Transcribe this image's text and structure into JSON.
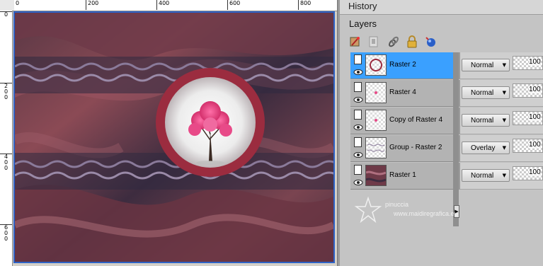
{
  "ruler": {
    "top_ticks": [
      "0",
      "200",
      "400",
      "600",
      "800"
    ],
    "left_ticks": [
      "0",
      "2\n0\n0",
      "4\n0\n0",
      "6\n0\n0"
    ]
  },
  "history": {
    "title": "History"
  },
  "layers": {
    "title": "Layers",
    "toolbar": [
      {
        "icon": "new-raster-layer-icon"
      },
      {
        "icon": "layer-properties-icon"
      },
      {
        "icon": "link-icon"
      },
      {
        "icon": "lock-icon"
      },
      {
        "icon": "blue-ball-icon"
      }
    ],
    "rows": [
      {
        "name": "Raster 2",
        "blend": "Normal",
        "opacity": "100",
        "selected": true
      },
      {
        "name": "Raster 4",
        "blend": "Normal",
        "opacity": "100",
        "selected": false
      },
      {
        "name": "Copy of Raster 4",
        "blend": "Normal",
        "opacity": "100",
        "selected": false
      },
      {
        "name": "Group - Raster 2",
        "blend": "Overlay",
        "opacity": "100",
        "selected": false
      },
      {
        "name": "Raster 1",
        "blend": "Normal",
        "opacity": "100",
        "selected": false
      }
    ]
  },
  "watermark": {
    "name": "pinuccia",
    "url": "www.maidiregrafica.eu"
  },
  "colors": {
    "selection": "#3aa0ff",
    "frame_border": "#2e63c7",
    "ring": "#9b2c3f"
  }
}
